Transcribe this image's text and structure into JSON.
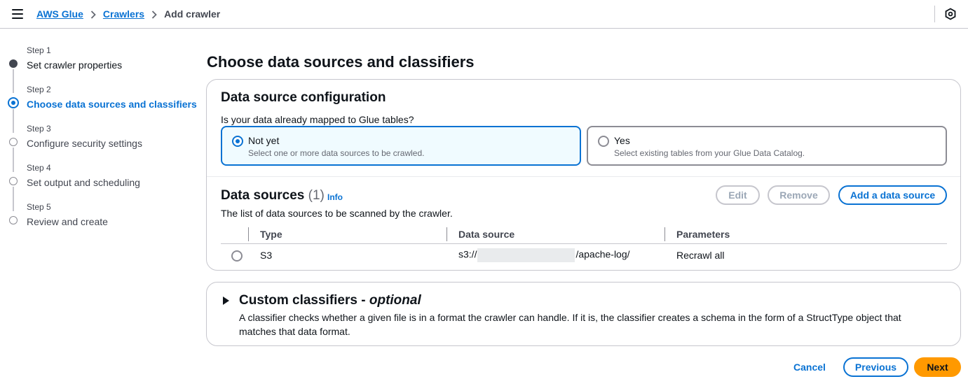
{
  "breadcrumb": {
    "items": [
      "AWS Glue",
      "Crawlers"
    ],
    "current": "Add crawler"
  },
  "steps": [
    {
      "num": "Step 1",
      "title": "Set crawler properties",
      "state": "done"
    },
    {
      "num": "Step 2",
      "title": "Choose data sources and classifiers",
      "state": "active"
    },
    {
      "num": "Step 3",
      "title": "Configure security settings",
      "state": "pending"
    },
    {
      "num": "Step 4",
      "title": "Set output and scheduling",
      "state": "pending"
    },
    {
      "num": "Step 5",
      "title": "Review and create",
      "state": "pending"
    }
  ],
  "page": {
    "title": "Choose data sources and classifiers"
  },
  "config": {
    "title": "Data source configuration",
    "question": "Is your data already mapped to Glue tables?",
    "options": [
      {
        "label": "Not yet",
        "desc": "Select one or more data sources to be crawled.",
        "selected": true
      },
      {
        "label": "Yes",
        "desc": "Select existing tables from your Glue Data Catalog.",
        "selected": false
      }
    ]
  },
  "data_sources": {
    "title": "Data sources",
    "count": "(1)",
    "info": "Info",
    "description": "The list of data sources to be scanned by the crawler.",
    "buttons": {
      "edit": "Edit",
      "remove": "Remove",
      "add": "Add a data source"
    },
    "columns": [
      "Type",
      "Data source",
      "Parameters"
    ],
    "rows": [
      {
        "type": "S3",
        "source_prefix": "s3://",
        "source_suffix": "/apache-log/",
        "parameters": "Recrawl all"
      }
    ]
  },
  "classifiers": {
    "title": "Custom classifiers -",
    "title_optional": "optional",
    "description": "A classifier checks whether a given file is in a format the crawler can handle. If it is, the classifier creates a schema in the form of a StructType object that matches that data format."
  },
  "footer": {
    "cancel": "Cancel",
    "previous": "Previous",
    "next": "Next"
  },
  "colors": {
    "accent": "#0972d3",
    "primary_button": "#ff9900",
    "selected_tile_bg": "#f0fbff"
  },
  "icons": [
    "hamburger-menu-icon",
    "chevron-right-icon",
    "settings-hexagon-icon",
    "caret-right-icon"
  ]
}
